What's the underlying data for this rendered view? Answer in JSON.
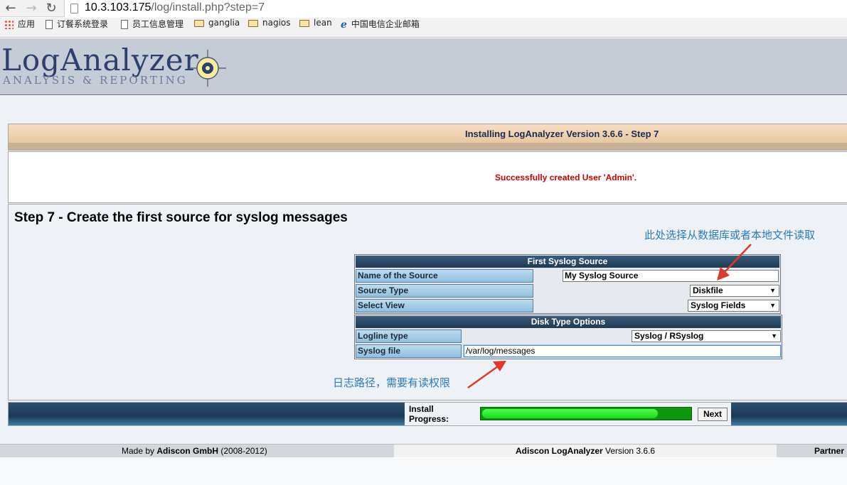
{
  "browser": {
    "url_host": "10.3.103.175",
    "url_path": "/log/install.php?step=7",
    "back_icon": "back-arrow-icon",
    "forward_icon": "forward-arrow-icon",
    "reload_icon": "reload-icon",
    "bookmarks": [
      {
        "label": "应用",
        "icon": "apps-icon"
      },
      {
        "label": "订餐系统登录",
        "icon": "page-icon"
      },
      {
        "label": "员工信息管理",
        "icon": "page-icon"
      },
      {
        "label": "ganglia",
        "icon": "folder-icon"
      },
      {
        "label": "nagios",
        "icon": "folder-icon"
      },
      {
        "label": "lean",
        "icon": "folder-icon"
      },
      {
        "label": "中国电信企业邮箱",
        "icon": "china-telecom-icon"
      }
    ]
  },
  "header": {
    "logo_main": "LogAnalyzer",
    "logo_sub": "ANALYSIS & REPORTING"
  },
  "install": {
    "title": "Installing LogAnalyzer Version 3.6.6 - Step 7",
    "success_message": "Successfully created User 'Admin'.",
    "step_title": "Step 7 - Create the first source for syslog messages"
  },
  "annotations": {
    "top": "此处选择从数据库或者本地文件读取",
    "bottom": "日志路径，需要有读权限"
  },
  "first_source": {
    "header": "First Syslog Source",
    "name_label": "Name of the Source",
    "name_value": "My Syslog Source",
    "type_label": "Source Type",
    "type_value": "Diskfile",
    "view_label": "Select View",
    "view_value": "Syslog Fields"
  },
  "disk_options": {
    "header": "Disk Type Options",
    "logline_label": "Logline type",
    "logline_value": "Syslog / RSyslog",
    "file_label": "Syslog file",
    "file_value": "/var/log/messages"
  },
  "progress": {
    "label_line1": "Install",
    "label_line2": "Progress:",
    "fraction": 0.84,
    "next_label": "Next"
  },
  "footer": {
    "made_by_prefix": "Made by",
    "made_by_company": "Adiscon GmbH",
    "made_by_years": "(2008-2012)",
    "product": "Adiscon LogAnalyzer",
    "version_text": "Version 3.6.6",
    "partner": "Partner"
  },
  "colors": {
    "success": "#cc0000",
    "annotation": "#2a7bbf",
    "arrow": "#e0392b",
    "progress": "#1cd81c"
  }
}
